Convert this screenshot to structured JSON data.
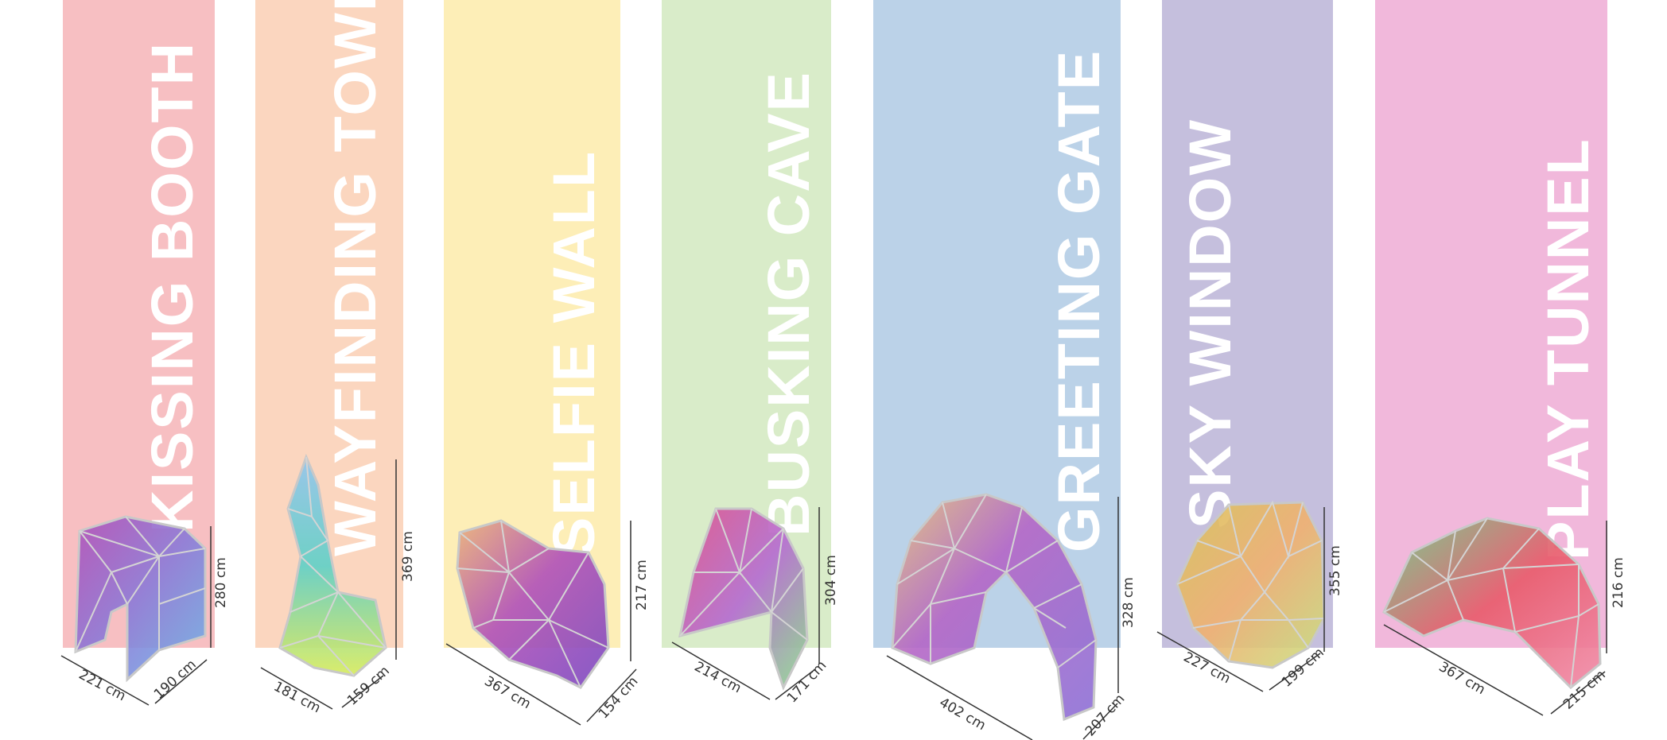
{
  "structures": [
    {
      "name": "KISSING BOOTH",
      "color": "#f7bfc2",
      "height": "280 cm",
      "length": "221 cm",
      "width": "190 cm"
    },
    {
      "name": "WAYFINDING TOWER",
      "color": "#fbd6bf",
      "height": "369 cm",
      "length": "181 cm",
      "width": "159 cm"
    },
    {
      "name": "SELFIE WALL",
      "color": "#fdeeb7",
      "height": "217 cm",
      "length": "367 cm",
      "width": "154 cm"
    },
    {
      "name": "BUSKING CAVE",
      "color": "#d9ecc9",
      "height": "304 cm",
      "length": "214 cm",
      "width": "171 cm"
    },
    {
      "name": "GREETING GATE",
      "color": "#bbd2e8",
      "height": "328 cm",
      "length": "402 cm",
      "width": "207 cm"
    },
    {
      "name": "SKY WINDOW",
      "color": "#c5bfdd",
      "height": "355 cm",
      "length": "227 cm",
      "width": "199 cm"
    },
    {
      "name": "PLAY TUNNEL",
      "color": "#f1b8db",
      "height": "216 cm",
      "length": "367 cm",
      "width": "215 cm"
    }
  ]
}
